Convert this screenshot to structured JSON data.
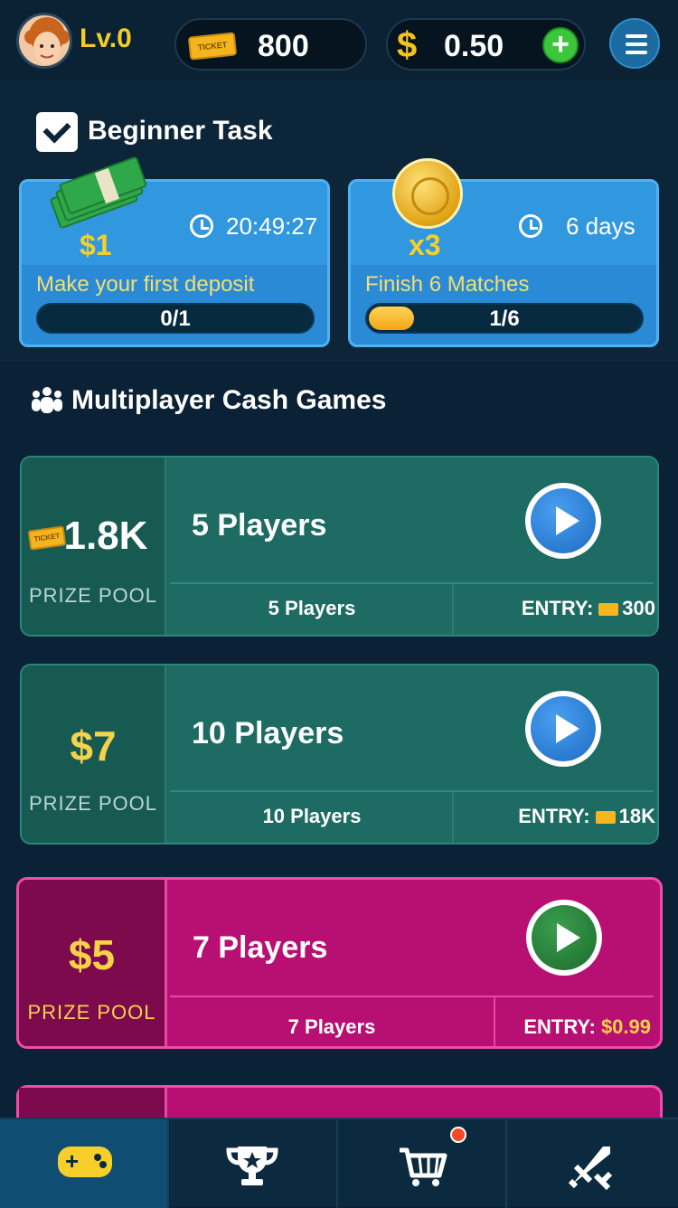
{
  "header": {
    "level": "Lv.0",
    "ticket_badge": "TICKET",
    "ticket_balance": "800",
    "cash_symbol": "$",
    "cash_balance": "0.50"
  },
  "beginner_task": {
    "title": "Beginner Task",
    "tasks": [
      {
        "reward": "$1",
        "timer": "20:49:27",
        "description": "Make your first deposit",
        "progress": "0/1",
        "progress_fraction": 0
      },
      {
        "reward": "x3",
        "timer": "6 days",
        "description": "Finish 6 Matches",
        "progress": "1/6",
        "progress_fraction": 0.1667
      }
    ]
  },
  "multiplayer": {
    "title": "Multiplayer Cash Games",
    "games": [
      {
        "prize": "1.8K",
        "prize_label": "PRIZE POOL",
        "name": "5 Players",
        "sub": "5 Players",
        "entry_label": "ENTRY:",
        "entry_amount": "300",
        "ticket_badge": "TICKET"
      },
      {
        "prize": "$7",
        "prize_label": "PRIZE POOL",
        "name": "10 Players",
        "sub": "10 Players",
        "entry_label": "ENTRY:",
        "entry_amount": "18K"
      },
      {
        "prize": "$5",
        "prize_label": "PRIZE POOL",
        "name": "7 Players",
        "sub": "7 Players",
        "entry_label": "ENTRY:",
        "entry_amount": "$0.99"
      }
    ]
  },
  "nav": {
    "tabs": [
      "games-icon",
      "trophy-icon",
      "cart-icon",
      "sword-icon"
    ],
    "active": "games-icon"
  },
  "colors": {
    "background": "#0b2236",
    "accent_gold": "#f6d24a",
    "teal_card": "#1d6b62",
    "pink_card": "#b80f72",
    "task_blue": "#3198e0"
  }
}
